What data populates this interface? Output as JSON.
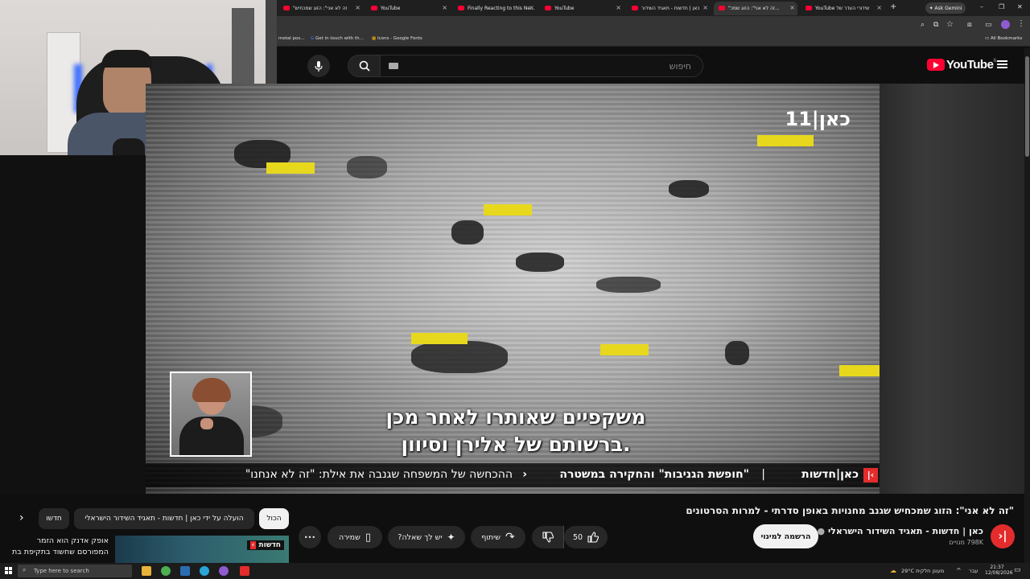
{
  "browser": {
    "tabs": [
      {
        "label": "\"זה לא אני\": הזוג שמכחיש",
        "active": false
      },
      {
        "label": "YouTube",
        "active": false
      },
      {
        "label": "Finally Reacting to this Ne...",
        "active": false
      },
      {
        "label": "YouTube",
        "active": false
      },
      {
        "label": "כאן | חדשות - תאגיד השידור",
        "active": false
      },
      {
        "label": "\"זה לא אני\": הזוג שמכ...",
        "active": true
      },
      {
        "label": "YouTube שידורי העדר של",
        "active": false
      }
    ],
    "ask_gemini": "Ask Gemini",
    "bookmarks": [
      "metal pos...",
      "Get in touch with th...",
      "Icons - Google Fonts"
    ],
    "all_bookmarks": "All Bookmarks"
  },
  "youtube": {
    "logo": "YouTube",
    "logo_region": "IL",
    "search_placeholder": "חיפוש"
  },
  "video": {
    "channel_watermark": "כאן|11",
    "subtitle_line1": "משקפיים שאותרו לאחר מכן",
    "subtitle_line2": "ברשותם של אלירן וסיוון.",
    "ticker_brand": "כאן|חדשות",
    "ticker_headline": "\"חופשת הגניבות\" והחקירה במשטרה",
    "ticker_separator": "|",
    "ticker_next": "ההכחשה של המשפחה שגנבה את אילת: \"זה לא אנחנו\"",
    "ticker_arrow": "‹"
  },
  "details": {
    "title": "\"זה לא אני\": הזוג שמכחיש שגנב מחנויות באופן סדרתי - למרות הסרטונים",
    "channel_name": "כאן | חדשות - תאגיד השידור הישראלי",
    "subscribers": "798K מנויים",
    "subscribe": "הרשמה למינוי",
    "likes": "50",
    "share": "שיתוף",
    "ask": "יש לך שאלה?",
    "save": "שמירה",
    "more": "•••"
  },
  "recommendations": {
    "chips": [
      "הכול",
      "הועלה על ידי כאן | חדשות - תאגיד השידור הישראלי",
      "חדשו"
    ],
    "next_chevron": "›",
    "first_title": "אופק אדנק הוא הזמר המפורסם שחשוד בתקיפת בת",
    "thumb_label": "חדשות"
  },
  "taskbar": {
    "search_placeholder": "Type here to search",
    "weather": "29°C  מעונן חלקית",
    "lang": "עבר",
    "time": "21:37",
    "date": "12/08/2026"
  },
  "colors": {
    "yt_red": "#ff0033",
    "kan_red": "#e42c2c",
    "bg": "#0f0f0f"
  }
}
